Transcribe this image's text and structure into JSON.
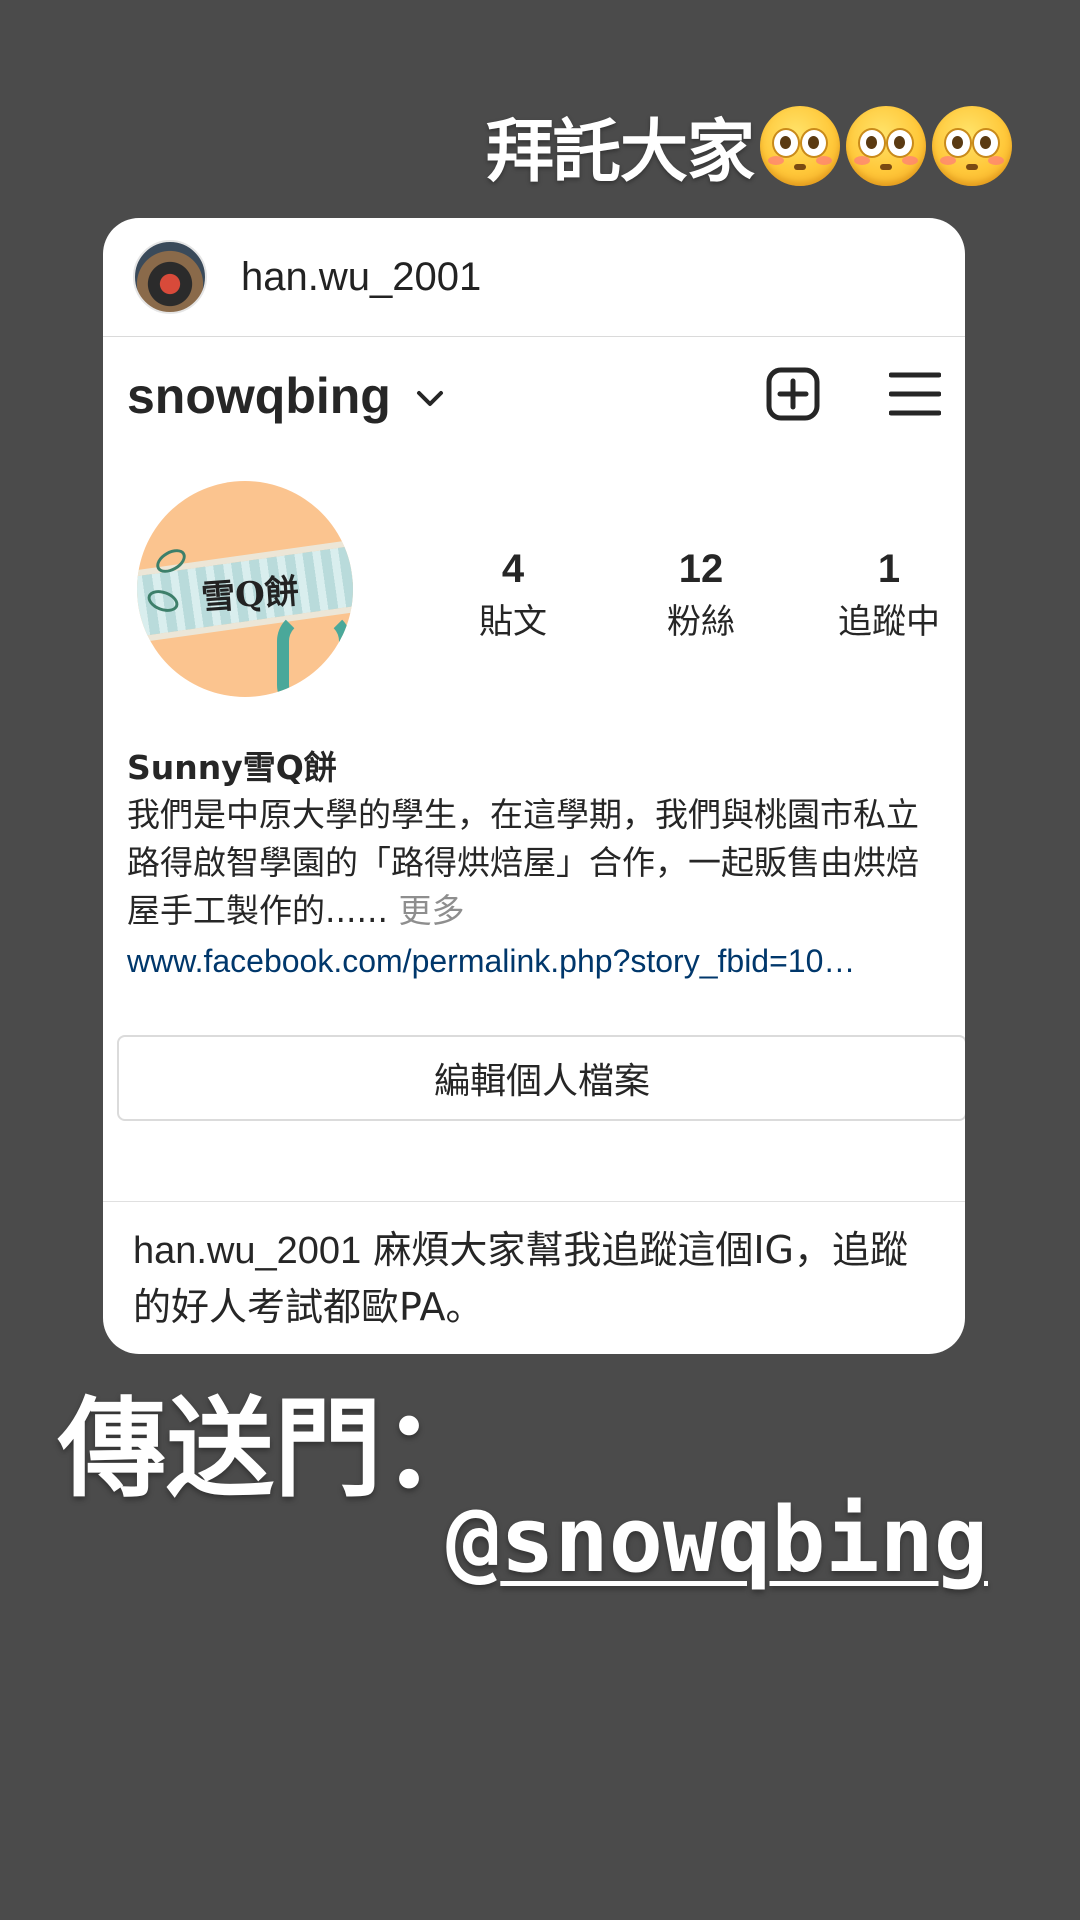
{
  "story": {
    "top_caption": "拜託大家",
    "top_emoji": "flushed-face-emoji",
    "portal_label": "傳送門：",
    "mention_at": "@",
    "mention_handle": "snowqbing"
  },
  "shared_post": {
    "sharer_username": "han.wu_2001",
    "profile": {
      "username": "snowqbing",
      "stats": [
        {
          "count": "4",
          "label": "貼文"
        },
        {
          "count": "12",
          "label": "粉絲"
        },
        {
          "count": "1",
          "label": "追蹤中"
        }
      ],
      "display_name": "Sunny雪Q餅",
      "bio": "我們是中原大學的學生，在這學期，我們與桃園市私立路得啟智學園的「路得烘焙屋」合作，一起販售由烘焙屋手工製作的......",
      "bio_more": "更多",
      "link": "www.facebook.com/permalink.php?story_fbid=10…",
      "avatar_text": "雪Q餅",
      "edit_button": "編輯個人檔案"
    },
    "caption": {
      "author": "han.wu_2001",
      "text": "麻煩大家幫我追蹤這個IG，追蹤的好人考試都歐PA。"
    }
  },
  "colors": {
    "background": "#4b4b4b",
    "card": "#ffffff",
    "link": "#00376b",
    "muted": "#8e8e8e"
  }
}
